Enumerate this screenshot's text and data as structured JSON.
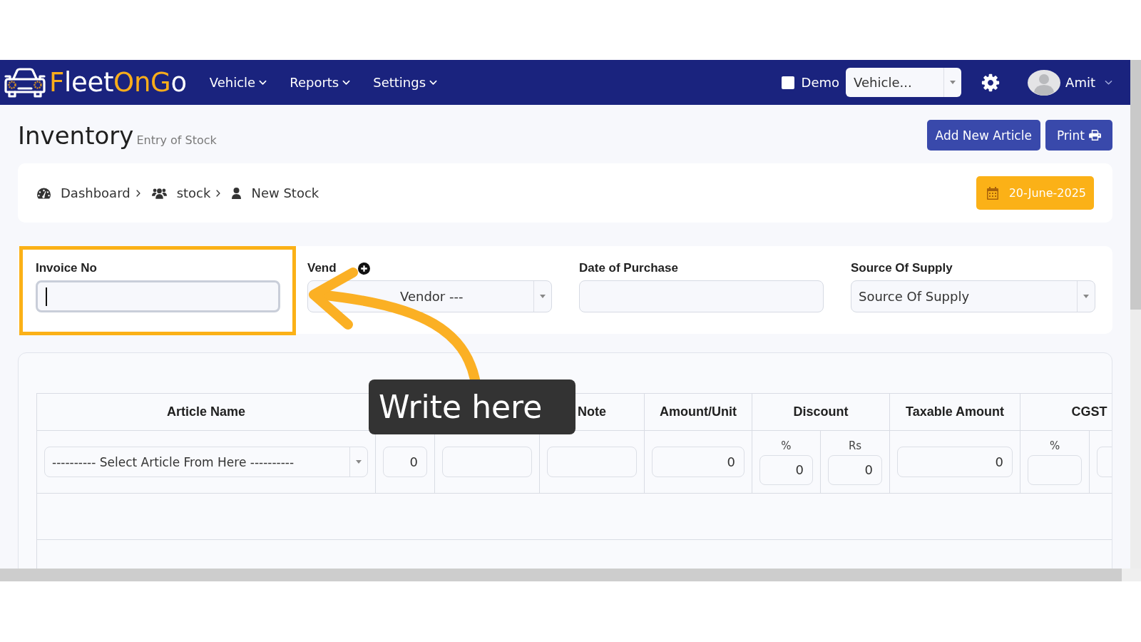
{
  "navbar": {
    "logo": [
      {
        "text": "F",
        "accent": true
      },
      {
        "text": "leet",
        "accent": false
      },
      {
        "text": "OnG",
        "accent": true
      },
      {
        "text": "o",
        "accent": false
      }
    ],
    "menus": [
      {
        "label": "Vehicle"
      },
      {
        "label": "Reports"
      },
      {
        "label": "Settings"
      }
    ],
    "demo": {
      "label": "Demo",
      "checked": false
    },
    "vehicle_select": {
      "value": "Vehicle..."
    },
    "user": {
      "name": "Amit"
    }
  },
  "header": {
    "title": "Inventory",
    "subtitle": "Entry of Stock",
    "buttons": [
      {
        "label": "Add New Article",
        "kind": "plain"
      },
      {
        "label": "Print",
        "kind": "print"
      }
    ]
  },
  "breadcrumb": {
    "items": [
      {
        "label": "Dashboard",
        "kind": "dashboard"
      },
      {
        "label": "stock",
        "kind": "users"
      },
      {
        "label": "New Stock",
        "kind": "user"
      }
    ],
    "date": "20-June-2025"
  },
  "form": {
    "fields": [
      {
        "label": "Invoice No",
        "kind": "input",
        "focused": true,
        "highlighted": true,
        "add_button": false
      },
      {
        "label": "Vend",
        "kind": "select",
        "value": "Vendor ---",
        "focused": false,
        "highlighted": false,
        "add_button": true,
        "value_covered": true
      },
      {
        "label": "Date of Purchase",
        "kind": "input",
        "focused": false,
        "highlighted": false,
        "add_button": false
      },
      {
        "label": "Source Of Supply",
        "kind": "select",
        "value": "Source Of Supply",
        "focused": false,
        "highlighted": false,
        "add_button": false,
        "value_covered": false
      }
    ]
  },
  "table": {
    "columns": [
      {
        "kind": "text",
        "label": "Article Name"
      },
      {
        "kind": "blank"
      },
      {
        "kind": "blank"
      },
      {
        "kind": "text",
        "label": "Note"
      },
      {
        "kind": "text",
        "label": "Amount/Unit"
      },
      {
        "kind": "text",
        "label": "Discount",
        "colspan": 2
      },
      {
        "kind": "text",
        "label": "Taxable Amount"
      },
      {
        "kind": "text",
        "label": "CGST",
        "colspan": 2
      }
    ],
    "rows": [
      {
        "cells": [
          {
            "kind": "select",
            "value": "---------- Select Article From Here ----------"
          },
          {
            "kind": "input",
            "value": "0"
          },
          {
            "kind": "input"
          },
          {
            "kind": "input"
          },
          {
            "kind": "input",
            "value": "0"
          },
          {
            "kind": "input",
            "label": "%",
            "value": "0"
          },
          {
            "kind": "input",
            "label": "Rs",
            "value": "0"
          },
          {
            "kind": "input",
            "value": "0"
          },
          {
            "kind": "input",
            "label": "%"
          },
          {
            "kind": "input"
          }
        ]
      }
    ]
  },
  "callout": {
    "text": "Write here"
  }
}
